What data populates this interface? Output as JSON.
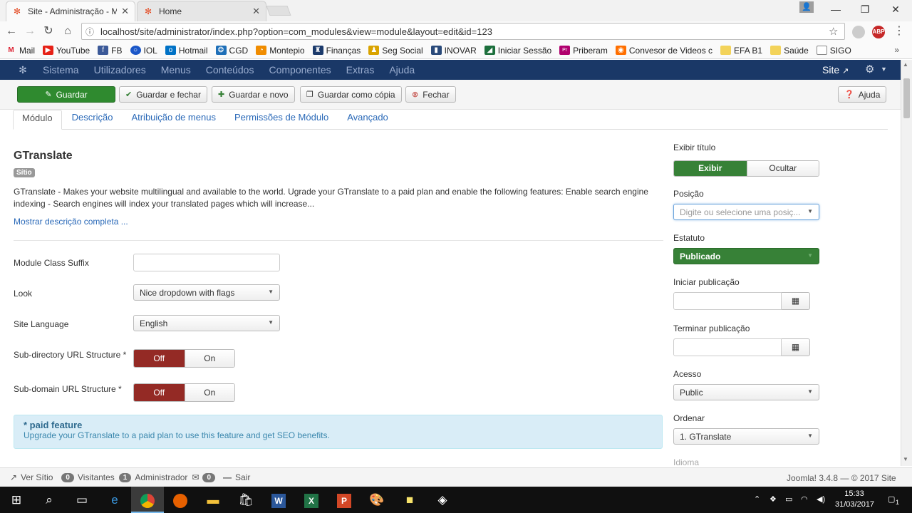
{
  "browser": {
    "tabs": [
      {
        "title": "Site - Administração - M",
        "active": true
      },
      {
        "title": "Home",
        "active": false
      }
    ],
    "url": "localhost/site/administrator/index.php?option=com_modules&view=module&layout=edit&id=123",
    "extension_badge": "ABP",
    "bookmarks": [
      "Mail",
      "YouTube",
      "FB",
      "IOL",
      "Hotmail",
      "CGD",
      "Montepio",
      "Finanças",
      "Seg Social",
      "INOVAR",
      "Iniciar Sessão",
      "Priberam",
      "Convesor de Videos c",
      "EFA B1",
      "Saúde",
      "SIGO"
    ],
    "bookmarks_overflow": "»"
  },
  "admin_menu": {
    "items": [
      "Sistema",
      "Utilizadores",
      "Menus",
      "Conteúdos",
      "Componentes",
      "Extras",
      "Ajuda"
    ],
    "site_link": "Site"
  },
  "toolbar": {
    "save": "Guardar",
    "save_close": "Guardar e fechar",
    "save_new": "Guardar e novo",
    "save_copy": "Guardar como cópia",
    "close": "Fechar",
    "help": "Ajuda"
  },
  "tabs": [
    "Módulo",
    "Descrição",
    "Atribuição de menus",
    "Permissões de Módulo",
    "Avançado"
  ],
  "module": {
    "title": "GTranslate",
    "badge": "Sítio",
    "description": "GTranslate - Makes your website multilingual and available to the world. Ugrade your GTranslate to a paid plan and enable the following features: Enable search engine indexing - Search engines will index your translated pages which will increase...",
    "show_more": "Mostrar descrição completa ..."
  },
  "form": {
    "class_suffix_label": "Module Class Suffix",
    "class_suffix_value": "",
    "look_label": "Look",
    "look_value": "Nice dropdown with flags",
    "language_label": "Site Language",
    "language_value": "English",
    "subdir_label": "Sub-directory URL Structure *",
    "subdomain_label": "Sub-domain URL Structure *",
    "toggle_off": "Off",
    "toggle_on": "On"
  },
  "paid_notice": {
    "heading": "* paid feature",
    "body": "Upgrade your GTranslate to a paid plan to use this feature and get SEO benefits."
  },
  "sidebar": {
    "show_title_label": "Exibir título",
    "show_title_on": "Exibir",
    "show_title_off": "Ocultar",
    "position_label": "Posição",
    "position_placeholder": "Digite ou selecione uma posiç...",
    "status_label": "Estatuto",
    "status_value": "Publicado",
    "start_label": "Iniciar publicação",
    "finish_label": "Terminar publicação",
    "access_label": "Acesso",
    "access_value": "Public",
    "order_label": "Ordenar",
    "order_value": "1. GTranslate",
    "language_label": "Idioma"
  },
  "statusbar": {
    "view_site": "Ver Sítio",
    "visitors_count": "0",
    "visitors_label": "Visitantes",
    "admin_count": "1",
    "admin_label": "Administrador",
    "messages_count": "0",
    "logout": "Sair",
    "version": "Joomla! 3.4.8  —  © 2017 Site"
  },
  "taskbar": {
    "time": "15:33",
    "date": "31/03/2017",
    "notification_count": "1"
  }
}
